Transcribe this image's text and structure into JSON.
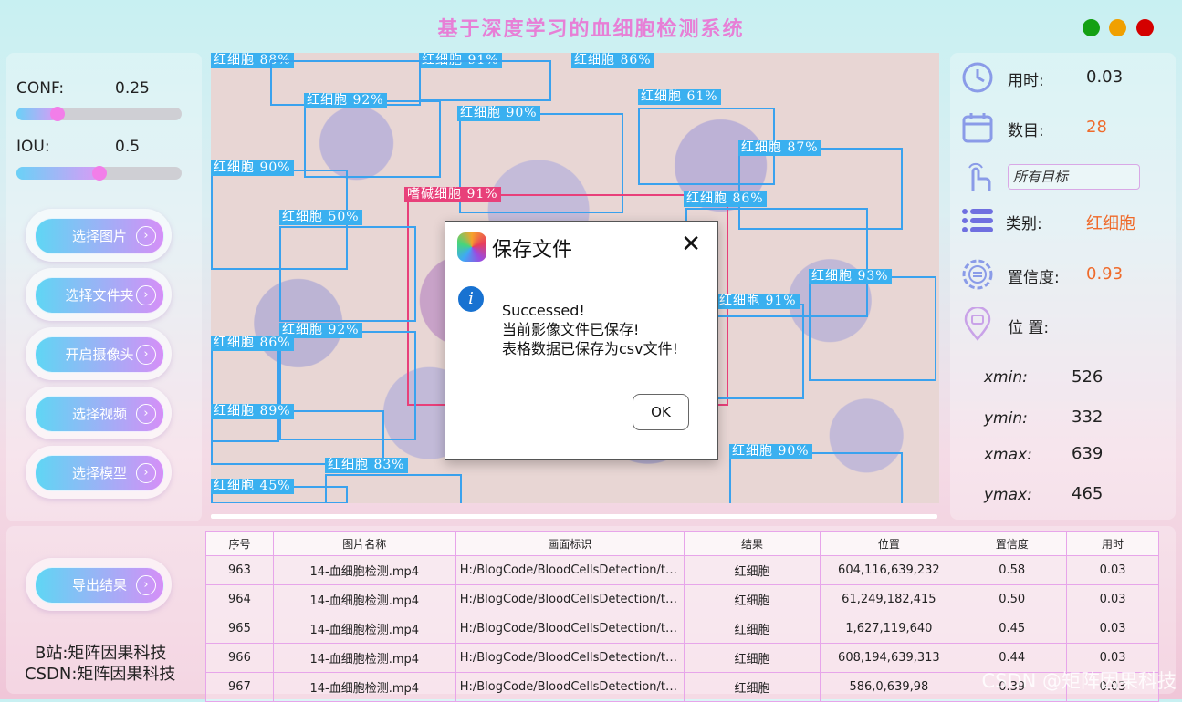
{
  "app": {
    "title": "基于深度学习的血细胞检测系统",
    "window_dots": [
      "#14a014",
      "#f0a000",
      "#d40000"
    ]
  },
  "params": {
    "conf_label": "CONF:",
    "conf_value": "0.25",
    "conf_level": 0.25,
    "iou_label": "IOU:",
    "iou_value": "0.5",
    "iou_level": 0.5
  },
  "buttons": {
    "select_image": "选择图片",
    "select_folder": "选择文件夹",
    "open_camera": "开启摄像头",
    "select_video": "选择视频",
    "select_model": "选择模型",
    "export_results": "导出结果"
  },
  "detections": [
    {
      "label": "红细胞 88%",
      "cls": "rbc"
    },
    {
      "label": "红细胞 91%",
      "cls": "rbc"
    },
    {
      "label": "红细胞 86%",
      "cls": "rbc"
    },
    {
      "label": "红细胞 92%",
      "cls": "rbc"
    },
    {
      "label": "红细胞 90%",
      "cls": "rbc"
    },
    {
      "label": "红细胞 61%",
      "cls": "rbc"
    },
    {
      "label": "红细胞 87%",
      "cls": "rbc"
    },
    {
      "label": "红细胞 90%",
      "cls": "rbc"
    },
    {
      "label": "嗜碱细胞 91%",
      "cls": "wbc"
    },
    {
      "label": "红细胞 86%",
      "cls": "rbc"
    },
    {
      "label": "红细胞 50%",
      "cls": "rbc"
    },
    {
      "label": "红细胞 93%",
      "cls": "rbc"
    },
    {
      "label": "红细胞 92%",
      "cls": "rbc"
    },
    {
      "label": "红细胞 86%",
      "cls": "rbc"
    },
    {
      "label": "红细胞 89%",
      "cls": "rbc"
    },
    {
      "label": "红细胞 83%",
      "cls": "rbc"
    },
    {
      "label": "红细胞 45%",
      "cls": "rbc"
    },
    {
      "label": "红细胞 90%",
      "cls": "rbc"
    },
    {
      "label": "红细胞 91%",
      "cls": "rbc"
    }
  ],
  "stats": {
    "time_label": "用时:",
    "time_value": "0.03",
    "count_label": "数目:",
    "count_value": "28",
    "target_select": "所有目标",
    "class_label": "类别:",
    "class_value": "红细胞",
    "conf_label": "置信度:",
    "conf_value": "0.93",
    "position_label": "位 置:",
    "xmin_label": "xmin:",
    "xmin": "526",
    "ymin_label": "ymin:",
    "ymin": "332",
    "xmax_label": "xmax:",
    "xmax": "639",
    "ymax_label": "ymax:",
    "ymax": "465"
  },
  "table": {
    "headers": [
      "序号",
      "图片名称",
      "画面标识",
      "结果",
      "位置",
      "置信度",
      "用时"
    ],
    "rows": [
      [
        "963",
        "14-血细胞检测.mp4",
        "H:/BlogCode/BloodCellsDetection/tes...",
        "红细胞",
        "604,116,639,232",
        "0.58",
        "0.03"
      ],
      [
        "964",
        "14-血细胞检测.mp4",
        "H:/BlogCode/BloodCellsDetection/tes...",
        "红细胞",
        "61,249,182,415",
        "0.50",
        "0.03"
      ],
      [
        "965",
        "14-血细胞检测.mp4",
        "H:/BlogCode/BloodCellsDetection/tes...",
        "红细胞",
        "1,627,119,640",
        "0.45",
        "0.03"
      ],
      [
        "966",
        "14-血细胞检测.mp4",
        "H:/BlogCode/BloodCellsDetection/tes...",
        "红细胞",
        "608,194,639,313",
        "0.44",
        "0.03"
      ],
      [
        "967",
        "14-血细胞检测.mp4",
        "H:/BlogCode/BloodCellsDetection/tes...",
        "红细胞",
        "586,0,639,98",
        "0.39",
        "0.03"
      ]
    ]
  },
  "credits": {
    "bilibili": "B站:矩阵因果科技",
    "csdn": "CSDN:矩阵因果科技",
    "watermark": "CSDN @矩阵因果科技"
  },
  "dialog": {
    "title": "保存文件",
    "close": "✕",
    "line1": "Successed!",
    "line2": "当前影像文件已保存!",
    "line3": "表格数据已保存为csv文件!",
    "ok": "OK",
    "info_glyph": "i"
  },
  "icons": {
    "chevron": "›"
  }
}
